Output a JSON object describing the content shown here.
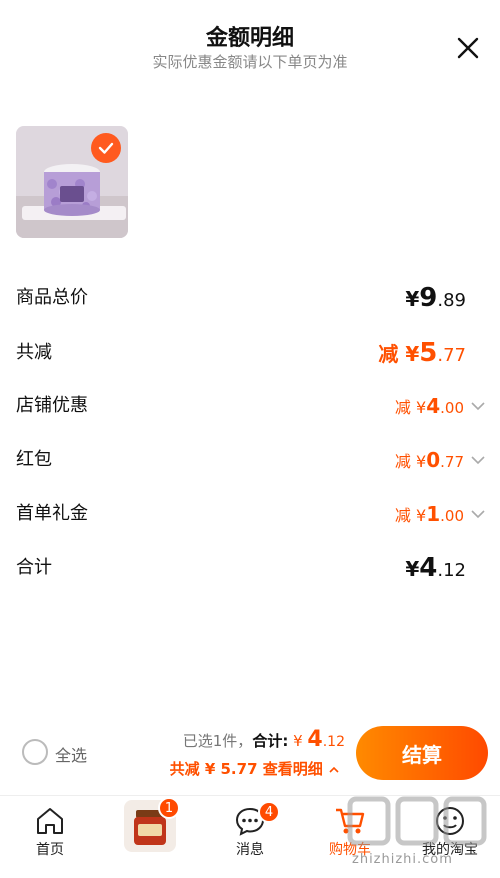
{
  "header": {
    "title": "金额明细",
    "subtitle": "实际优惠金额请以下单页为准"
  },
  "rows": [
    {
      "label": "商品总价",
      "prefix": "",
      "currency": "¥",
      "int": "9",
      "dec": ".89"
    },
    {
      "label": "共减",
      "prefix": "减",
      "currency": "¥",
      "int": "5",
      "dec": ".77"
    },
    {
      "label": "店铺优惠",
      "prefix": "减",
      "currency": "¥",
      "int": "4",
      "dec": ".00"
    },
    {
      "label": "红包",
      "prefix": "减",
      "currency": "¥",
      "int": "0",
      "dec": ".77"
    },
    {
      "label": "首单礼金",
      "prefix": "减",
      "currency": "¥",
      "int": "1",
      "dec": ".00"
    },
    {
      "label": "合计",
      "prefix": "",
      "currency": "¥",
      "int": "4",
      "dec": ".12"
    }
  ],
  "bottom": {
    "select_all": "全选",
    "selected_count": "已选1件，",
    "total_label": "合计:",
    "total_currency": "¥",
    "total_int": "4",
    "total_dec": ".12",
    "saved": "共减 ¥ 5.77",
    "details_link": "查看明细",
    "checkout": "结算"
  },
  "tabs": [
    {
      "label": "首页",
      "icon": "home-icon"
    },
    {
      "label": "",
      "icon": "recommended-product-thumbnail",
      "badge": "1"
    },
    {
      "label": "消息",
      "icon": "message-icon",
      "badge": "4"
    },
    {
      "label": "购物车",
      "icon": "cart-icon",
      "active": true
    },
    {
      "label": "我的淘宝",
      "icon": "profile-icon"
    }
  ],
  "watermark": {
    "text": "zhizhizhi.com"
  },
  "colors": {
    "accent": "#ff5000",
    "checkout_start": "#ff8a00",
    "checkout_end": "#ff4a00"
  }
}
